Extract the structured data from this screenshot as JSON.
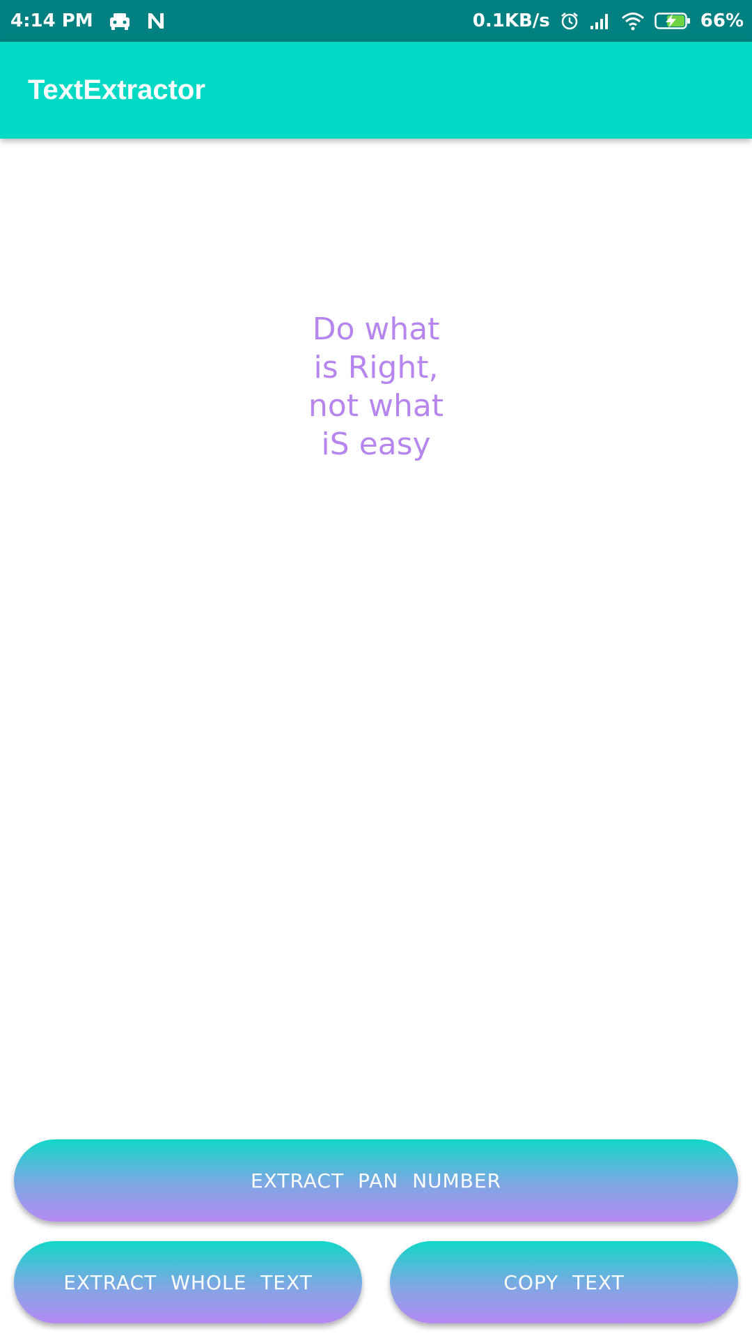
{
  "status_bar": {
    "time": "4:14 PM",
    "net_speed": "0.1KB/s",
    "battery": "66%",
    "icons": [
      "notification-car-icon",
      "n-app-icon",
      "alarm-icon",
      "signal-icon",
      "wifi-icon",
      "battery-charging-icon"
    ]
  },
  "app_bar": {
    "title": "TextExtractor"
  },
  "main": {
    "extracted_text": "Do what\nis Right,\nnot what\niS easy"
  },
  "buttons": {
    "extract_pan": "EXTRACT PAN NUMBER",
    "extract_whole": "EXTRACT WHOLE TEXT",
    "copy_text": "COPY TEXT"
  },
  "colors": {
    "status_bar": "#008080",
    "app_bar": "#03dac6",
    "text": "#b685ed",
    "button_top": "#13d6c8",
    "button_bottom": "#b68af3"
  }
}
